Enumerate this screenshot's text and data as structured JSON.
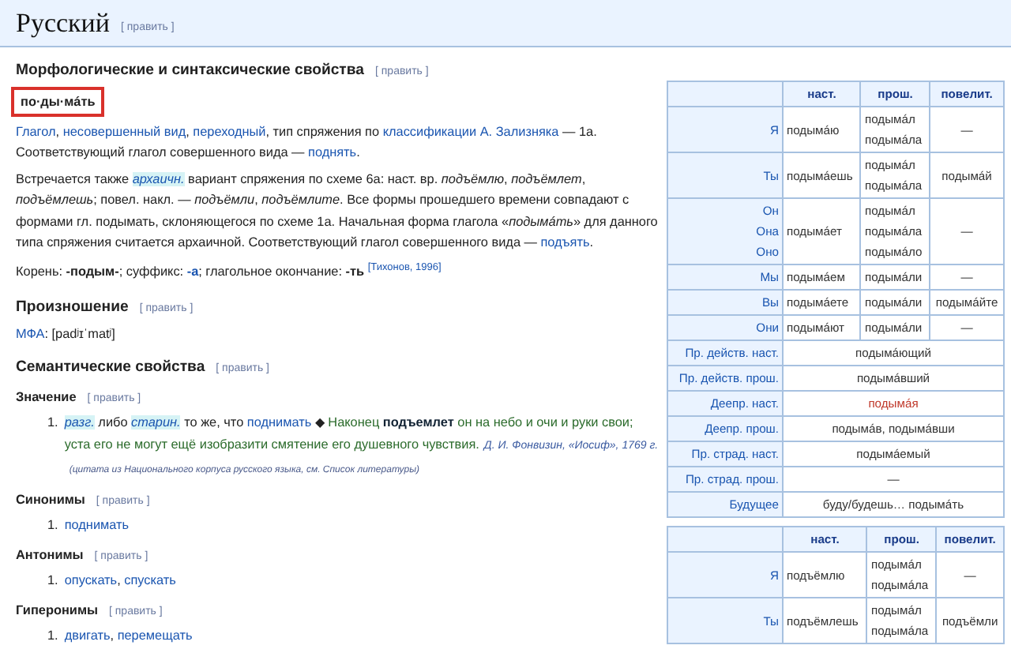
{
  "language_header": {
    "title": "Русский",
    "edit_link": "[ править ]"
  },
  "morphology": {
    "heading": "Морфологические и синтаксические свойства",
    "edit_link": "[ править ]",
    "syllables": {
      "text": "по·ды·мáть",
      "outlined": true
    },
    "paragraphs": [
      [
        {
          "kind": "link",
          "text": "Глагол"
        },
        {
          "kind": "text",
          "text": ", "
        },
        {
          "kind": "link",
          "text": "несовершенный вид"
        },
        {
          "kind": "text",
          "text": ", "
        },
        {
          "kind": "link",
          "text": "переходный"
        },
        {
          "kind": "text",
          "text": ", тип спряжения по "
        },
        {
          "kind": "link",
          "text": "классификации А. Зализняка"
        },
        {
          "kind": "text",
          "text": " — 1a. Соответствующий глагол совершенного вида — "
        },
        {
          "kind": "link",
          "text": "поднять"
        },
        {
          "kind": "text",
          "text": "."
        }
      ],
      [
        {
          "kind": "text",
          "text": "Встречается также "
        },
        {
          "kind": "tag",
          "text": "архаичн."
        },
        {
          "kind": "text",
          "text": " вариант спряжения по схеме 6a: наст. вр. *подъёмлю*, *подъёмлет*, *подъёмлешь*; повел. накл. — *подъёмли*, *подъёмлите*. Все формы прошедшего времени совпадают с формами гл. подымать, склоняющегося по схеме 1a. Начальная форма глагола «*подымáть*» для данного типа спряжения считается архаичной. Соответствующий глагол совершенного вида — "
        },
        {
          "kind": "link",
          "text": "подъять"
        },
        {
          "kind": "text",
          "text": "."
        }
      ],
      [
        {
          "kind": "text",
          "text": "Корень: **-подым-**; суффикс: "
        },
        {
          "kind": "boldlink",
          "text": "-а"
        },
        {
          "kind": "text",
          "text": "; глагольное окончание: **-ть** "
        },
        {
          "kind": "ref",
          "text": "[Тихонов, 1996]"
        }
      ]
    ]
  },
  "pronunciation": {
    "heading": "Произношение",
    "edit_link": "[ править ]",
    "line": [
      {
        "kind": "link",
        "text": "МФА"
      },
      {
        "kind": "text",
        "text": ": [padʲɪˈmatʲ]"
      }
    ]
  },
  "semantics": {
    "heading": "Семантические свойства",
    "edit_link": "[ править ]",
    "subsections": [
      {
        "heading": "Значение",
        "edit_link": "[ править ]",
        "items": [
          {
            "number": "1.",
            "segments": [
              {
                "kind": "tag",
                "text": "разг."
              },
              {
                "kind": "text",
                "text": " либо "
              },
              {
                "kind": "tag",
                "text": "старин."
              },
              {
                "kind": "text",
                "text": " то же, что "
              },
              {
                "kind": "link",
                "text": "поднимать"
              },
              {
                "kind": "text",
                "text": " ◆ "
              },
              {
                "kind": "quote",
                "text": "Наконец **подъемлет** он на небо и очи и руки свои; уста его не могут ещё изобразити смятение его душевного чувствия."
              },
              {
                "kind": "cite",
                "text": "Д. И. Фонвизин, «Иосиф», 1769 г."
              },
              {
                "kind": "note",
                "text": "(цитата из Национального корпуса русского языка, см. Список литературы)"
              }
            ]
          }
        ]
      },
      {
        "heading": "Синонимы",
        "edit_link": "[ править ]",
        "items": [
          {
            "number": "1.",
            "segments": [
              {
                "kind": "link",
                "text": "поднимать"
              }
            ]
          }
        ]
      },
      {
        "heading": "Антонимы",
        "edit_link": "[ править ]",
        "items": [
          {
            "number": "1.",
            "segments": [
              {
                "kind": "link",
                "text": "опускать"
              },
              {
                "kind": "text",
                "text": ", "
              },
              {
                "kind": "link",
                "text": "спускать"
              }
            ]
          }
        ]
      },
      {
        "heading": "Гиперонимы",
        "edit_link": "[ править ]",
        "items": [
          {
            "number": "1.",
            "segments": [
              {
                "kind": "link",
                "text": "двигать"
              },
              {
                "kind": "text",
                "text": ", "
              },
              {
                "kind": "link",
                "text": "перемещать"
              }
            ]
          }
        ]
      }
    ]
  },
  "conjugation_tables": [
    {
      "columns": [
        "наст.",
        "прош.",
        "повелит."
      ],
      "rows": [
        {
          "kind": "person",
          "persons": [
            "Я"
          ],
          "present": "подымáю",
          "past": [
            "подымáл",
            "подымáла"
          ],
          "imperative": "—"
        },
        {
          "kind": "person",
          "persons": [
            "Ты"
          ],
          "present": "подымáешь",
          "past": [
            "подымáл",
            "подымáла"
          ],
          "imperative": "подымáй"
        },
        {
          "kind": "person",
          "persons": [
            "Он",
            "Она",
            "Оно"
          ],
          "present": "подымáет",
          "past": [
            "подымáл",
            "подымáла",
            "подымáло"
          ],
          "imperative": "—"
        },
        {
          "kind": "person",
          "persons": [
            "Мы"
          ],
          "present": "подымáем",
          "past": [
            "подымáли"
          ],
          "imperative": "—"
        },
        {
          "kind": "person",
          "persons": [
            "Вы"
          ],
          "present": "подымáете",
          "past": [
            "подымáли"
          ],
          "imperative": "подымáйте"
        },
        {
          "kind": "person",
          "persons": [
            "Они"
          ],
          "present": "подымáют",
          "past": [
            "подымáли"
          ],
          "imperative": "—"
        },
        {
          "kind": "form",
          "label": "Пр. действ. наст.",
          "value": "подымáющий",
          "accent": false
        },
        {
          "kind": "form",
          "label": "Пр. действ. прош.",
          "value": "подымáвший",
          "accent": false
        },
        {
          "kind": "form",
          "label": "Деепр. наст.",
          "value": "подымáя",
          "accent": true
        },
        {
          "kind": "form",
          "label": "Деепр. прош.",
          "value": "подымáв, подымáвши",
          "accent": false
        },
        {
          "kind": "form",
          "label": "Пр. страд. наст.",
          "value": "подымáемый",
          "accent": false
        },
        {
          "kind": "form",
          "label": "Пр. страд. прош.",
          "value": "—",
          "accent": false
        },
        {
          "kind": "form",
          "label": "Будущее",
          "value": "буду/будешь… подымáть",
          "accent": false
        }
      ]
    },
    {
      "columns": [
        "наст.",
        "прош.",
        "повелит."
      ],
      "rows": [
        {
          "kind": "person",
          "persons": [
            "Я"
          ],
          "present": "подъёмлю",
          "past": [
            "подымáл",
            "подымáла"
          ],
          "imperative": "—"
        },
        {
          "kind": "person",
          "persons": [
            "Ты"
          ],
          "present": "подъёмлешь",
          "past": [
            "подымáл",
            "подымáла"
          ],
          "imperative": "подъёмли"
        }
      ]
    }
  ]
}
